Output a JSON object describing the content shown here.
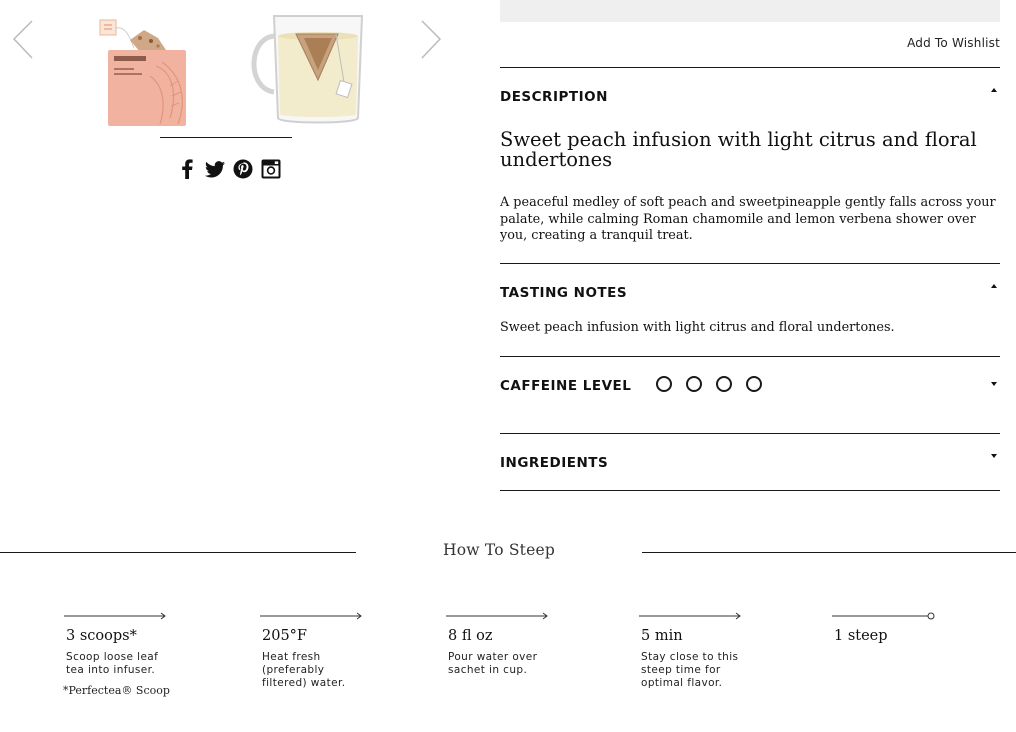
{
  "gallery": {
    "images": [
      {
        "name": "peach-tranquility-sachet",
        "brand_text": "TEAVANA",
        "product_text": "PEACH TRANQUILITY"
      },
      {
        "name": "glass-mug-with-sachet"
      }
    ],
    "prev_icon": "chevron-left-icon",
    "next_icon": "chevron-right-icon",
    "social": [
      "facebook-icon",
      "twitter-icon",
      "pinterest-icon",
      "instagram-icon"
    ]
  },
  "actions": {
    "wishlist_label": "Add To Wishlist"
  },
  "description": {
    "heading": "DESCRIPTION",
    "state": "expanded",
    "title": "Sweet peach infusion with light citrus and floral undertones",
    "body": "A peaceful medley of soft peach and sweetpineapple gently falls across your palate, while calming Roman chamomile and lemon verbena shower over you, creating a tranquil treat."
  },
  "tasting_notes": {
    "heading": "TASTING NOTES",
    "state": "expanded",
    "body": "Sweet peach infusion with light citrus and floral undertones."
  },
  "caffeine": {
    "heading": "CAFFEINE LEVEL",
    "state": "collapsed",
    "level": 0,
    "max": 4
  },
  "ingredients": {
    "heading": "INGREDIENTS",
    "state": "collapsed"
  },
  "steep": {
    "title": "How To Steep",
    "steps": [
      {
        "value": "3 scoops*",
        "desc": "Scoop loose leaf tea into infuser.",
        "note": "*Perfectea® Scoop"
      },
      {
        "value": "205°F",
        "desc": "Heat fresh (preferably filtered) water."
      },
      {
        "value": "8 fl oz",
        "desc": "Pour water over sachet in cup."
      },
      {
        "value": "5 min",
        "desc": "Stay close to this steep time for optimal flavor."
      },
      {
        "value": "1 steep",
        "desc": ""
      }
    ]
  },
  "colors": {
    "text": "#1a1a1a",
    "top_bar": "#efefef",
    "sachet": "#f1b3a0",
    "arrow": "#bbbbbb"
  }
}
